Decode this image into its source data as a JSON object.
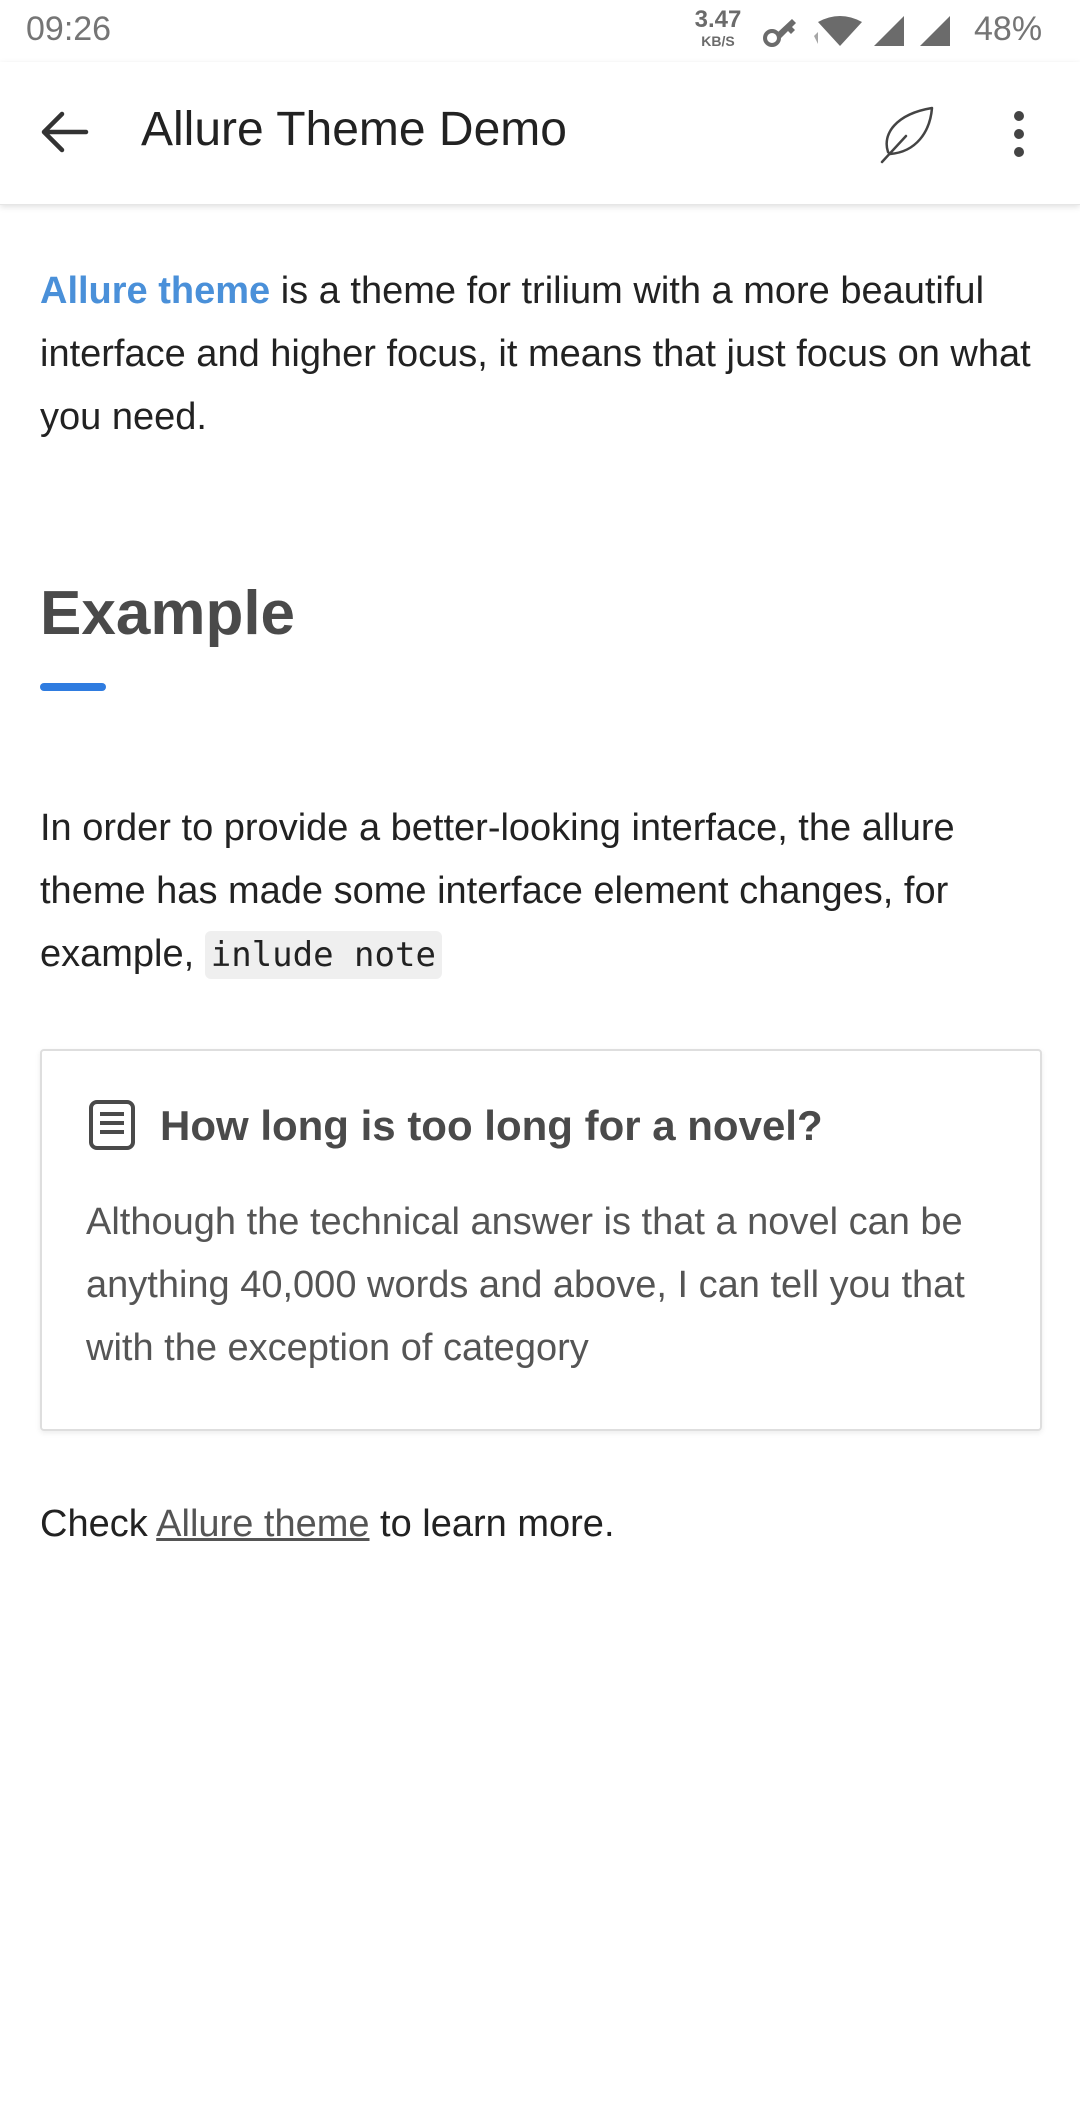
{
  "status_bar": {
    "time": "09:26",
    "net_speed": "3.47",
    "net_speed_unit": "KB/S",
    "battery": "48%",
    "icons": [
      "vpn-key-icon",
      "wifi-icon",
      "signal-icon",
      "signal-icon"
    ]
  },
  "app_bar": {
    "title": "Allure Theme Demo",
    "icons": [
      "back-arrow-icon",
      "feather-icon",
      "more-vert-icon"
    ]
  },
  "note": {
    "intro_link": "Allure theme",
    "intro_text": " is a theme for trilium with a more beautiful interface and higher focus, it means that just focus on what you need.",
    "heading": "Example",
    "paragraph": "In order to provide a better-looking interface, the allure theme has made some interface element changes, for example, ",
    "code": "inlude note",
    "included_note": {
      "icon": "note-icon",
      "title": "How long is too long for a novel?",
      "body": "Although the technical answer is that a novel can be anything 40,000 words and above, I can tell you that with the exception of category"
    },
    "footer_prefix": "Check ",
    "footer_link": "Allure theme",
    "footer_suffix": " to learn more."
  },
  "colors": {
    "link": "#4a90d9",
    "accent": "#2f7ce0"
  }
}
